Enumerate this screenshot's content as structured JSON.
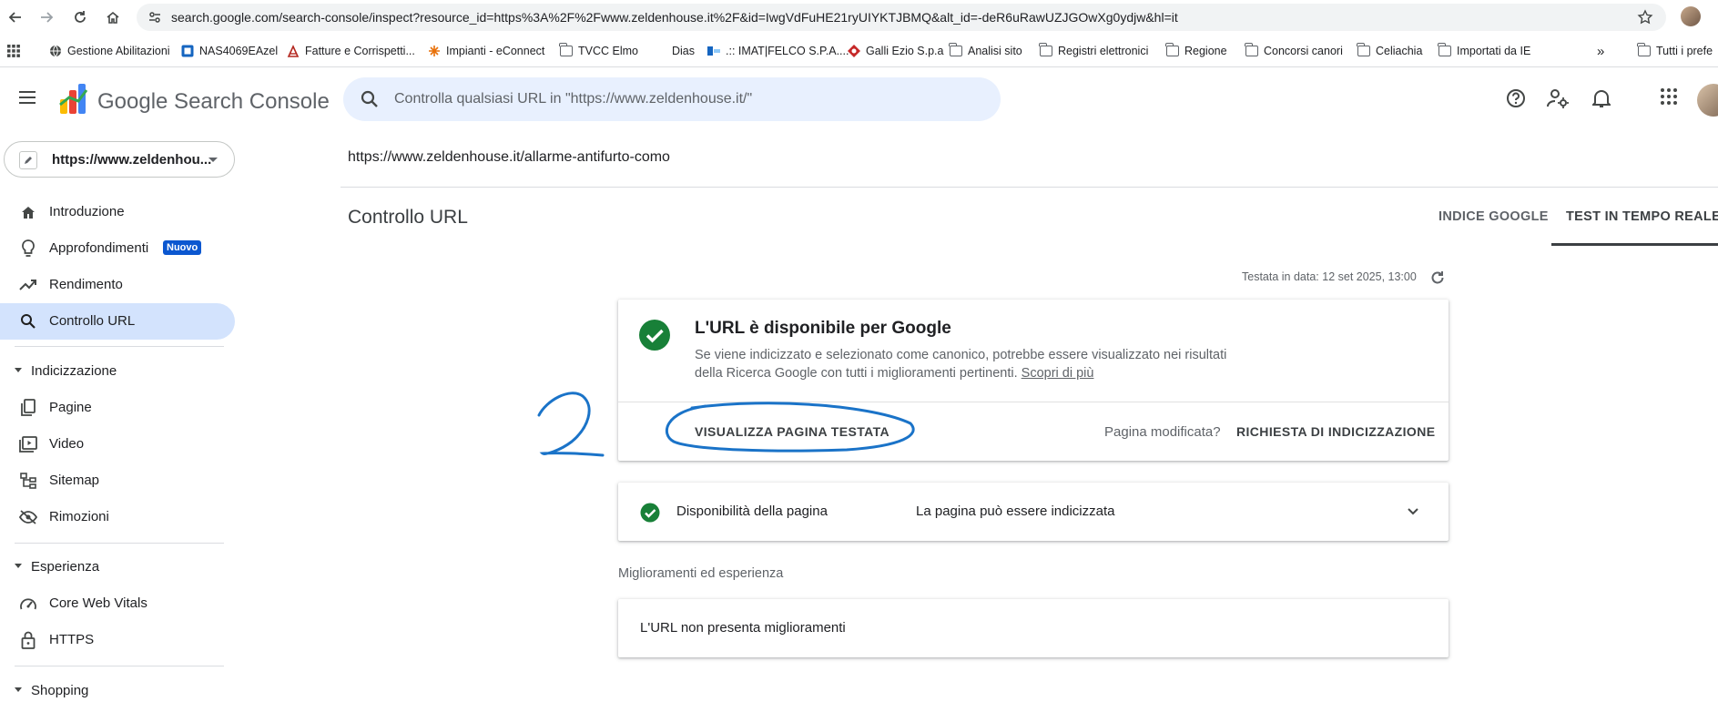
{
  "browser": {
    "url": "search.google.com/search-console/inspect?resource_id=https%3A%2F%2Fwww.zeldenhouse.it%2F&id=IwgVdFuHE21ryUIYKTJBMQ&alt_id=-deR6uRawUZJGOwXg0ydjw&hl=it",
    "bookmarks": [
      {
        "label": "Gestione Abilitazioni",
        "icon": "globe-icon"
      },
      {
        "label": "NAS4069EAzel",
        "icon": "nas-icon"
      },
      {
        "label": "Fatture e Corrispetti...",
        "icon": "receipt-icon"
      },
      {
        "label": "Impianti - eConnect",
        "icon": "econnect-icon"
      },
      {
        "label": "TVCC Elmo",
        "icon": "folder-icon"
      },
      {
        "label": "Dias",
        "icon": "blank-icon"
      },
      {
        "label": ".:: IMAT|FELCO S.P.A....",
        "icon": "imat-icon"
      },
      {
        "label": "Galli Ezio S.p.a",
        "icon": "galli-icon"
      },
      {
        "label": "Analisi sito",
        "icon": "folder-icon"
      },
      {
        "label": "Registri elettronici",
        "icon": "folder-icon"
      },
      {
        "label": "Regione",
        "icon": "folder-icon"
      },
      {
        "label": "Concorsi canori",
        "icon": "folder-icon"
      },
      {
        "label": "Celiachia",
        "icon": "folder-icon"
      },
      {
        "label": "Importati da IE",
        "icon": "folder-icon"
      }
    ],
    "overflow": "»",
    "all_bookmarks": "Tutti i prefe"
  },
  "header": {
    "brand": "Google Search Console",
    "search_placeholder": "Controlla qualsiasi URL in \"https://www.zeldenhouse.it/\""
  },
  "sidebar": {
    "property": "https://www.zeldenhou...",
    "items": [
      {
        "label": "Introduzione",
        "icon": "home-icon"
      },
      {
        "label": "Approfondimenti",
        "icon": "lightbulb-icon",
        "badge": "Nuovo"
      },
      {
        "label": "Rendimento",
        "icon": "trend-icon"
      },
      {
        "label": "Controllo URL",
        "icon": "search-icon"
      }
    ],
    "section_indexing": "Indicizzazione",
    "indexing_items": [
      {
        "label": "Pagine",
        "icon": "pages-icon"
      },
      {
        "label": "Video",
        "icon": "video-icon"
      },
      {
        "label": "Sitemap",
        "icon": "sitemap-icon"
      },
      {
        "label": "Rimozioni",
        "icon": "removals-icon"
      }
    ],
    "section_experience": "Esperienza",
    "experience_items": [
      {
        "label": "Core Web Vitals",
        "icon": "gauge-icon"
      },
      {
        "label": "HTTPS",
        "icon": "lock-icon"
      }
    ],
    "section_shopping": "Shopping"
  },
  "main": {
    "inspected_url": "https://www.zeldenhouse.it/allarme-antifurto-como",
    "title": "Controllo URL",
    "tabs": [
      {
        "label": "INDICE GOOGLE"
      },
      {
        "label": "TEST IN TEMPO REALE"
      }
    ],
    "tested_on": "Testata in data: 12 set 2025, 13:00",
    "status_card": {
      "heading": "L'URL è disponibile per Google",
      "description": "Se viene indicizzato e selezionato come canonico, potrebbe essere visualizzato nei risultati della Ricerca Google con tutti i miglioramenti pertinenti.",
      "learn_more": "Scopri di più",
      "view_button": "VISUALIZZA PAGINA TESTATA",
      "page_modified": "Pagina modificata?",
      "request_button": "RICHIESTA DI INDICIZZAZIONE"
    },
    "availability": {
      "label": "Disponibilità della pagina",
      "value": "La pagina può essere indicizzata"
    },
    "enhancements_title": "Miglioramenti ed esperienza",
    "enhancements_text": "L'URL non presenta miglioramenti"
  },
  "annotation": {
    "number": "2",
    "color": "#1a73c8"
  },
  "colors": {
    "accent": "#0b57d0",
    "active_nav": "#d3e3fd",
    "success": "#188038",
    "search_bg": "#e8f0fe"
  }
}
